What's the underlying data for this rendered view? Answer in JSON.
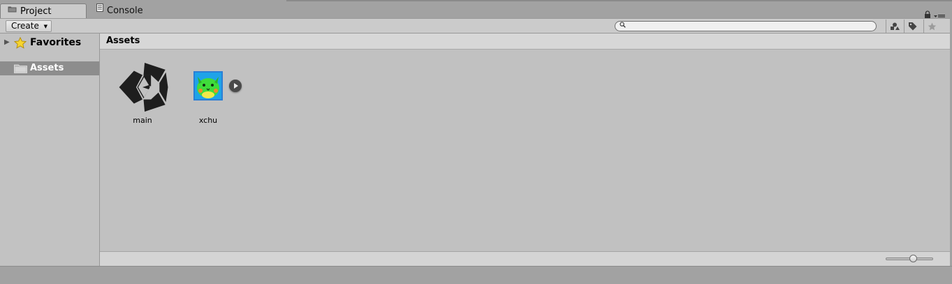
{
  "tabs": [
    {
      "label": "Project",
      "icon": "folder-icon",
      "active": true
    },
    {
      "label": "Console",
      "icon": "console-icon",
      "active": false
    }
  ],
  "toolbar": {
    "create_label": "Create",
    "search_placeholder": "",
    "right_icons": [
      "filter-by-type-icon",
      "filter-by-label-icon",
      "favorite-star-icon"
    ]
  },
  "sidebar": {
    "favorites_label": "Favorites",
    "assets_label": "Assets"
  },
  "main": {
    "breadcrumb": "Assets",
    "items": [
      {
        "name": "main",
        "icon": "unity-scene-icon"
      },
      {
        "name": "xchu",
        "icon": "image-thumbnail"
      }
    ],
    "zoom_level": 0.6
  },
  "colors": {
    "selected_row": "#8d8d8d",
    "panel_bg": "#c1c1c1",
    "header_bg": "#d7d7d7"
  }
}
